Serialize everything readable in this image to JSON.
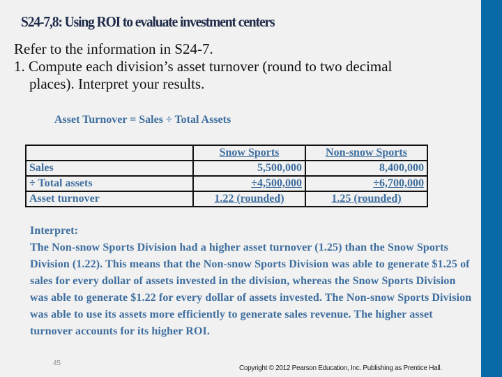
{
  "slide": {
    "title": "S24-7,8:   Using ROI to evaluate investment centers",
    "intro": {
      "line1": "Refer to the information in S24-7.",
      "line2": "1. Compute each division’s asset turnover (round to two decimal",
      "line3": "places). Interpret your results."
    },
    "formula": "Asset Turnover = Sales ÷ Total Assets",
    "table": {
      "headers": [
        "",
        "Snow Sports",
        "Non-snow Sports"
      ],
      "rows": [
        [
          "Sales",
          "5,500,000",
          "8,400,000"
        ],
        [
          "÷ Total assets",
          "÷4,500,000",
          "÷6,700,000"
        ],
        [
          "Asset turnover",
          "1.22 (rounded)",
          "1.25 (rounded)"
        ]
      ]
    },
    "interpret": {
      "label": "Interpret:",
      "text": "The Non-snow Sports Division had a higher asset turnover (1.25) than the Snow Sports Division (1.22). This means that the Non-snow Sports Division was able to generate $1.25 of sales for every dollar of assets invested in the division, whereas the Snow Sports Division was able to generate $1.22 for every dollar of assets invested. The Non-snow Sports Division was able to use its assets more efficiently to generate sales revenue. The higher asset turnover accounts for its higher ROI."
    },
    "slide_number": "45",
    "copyright": "Copyright © 2012 Pearson Education, Inc. Publishing as Prentice Hall.",
    "colors": {
      "background": "#f1f1f1",
      "sidebar": "#0a6aa8",
      "title": "#1d2a48",
      "accent_text": "#3e6e9e"
    }
  }
}
